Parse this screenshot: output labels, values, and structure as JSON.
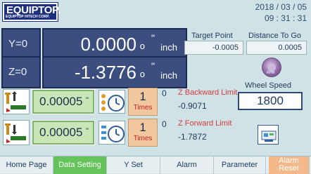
{
  "header": {
    "logo_main": "EQUIPTOP.",
    "logo_sub": "EQUIPTOP HITECH CORP.",
    "date": "2018 / 03 / 05",
    "time": "09 : 31 : 31"
  },
  "axes": [
    {
      "label": "Y=0",
      "value": "0.0000",
      "suffix": "o",
      "tick": "\"",
      "unit": "inch"
    },
    {
      "label": "Z=0",
      "value": "-1.3776",
      "suffix": "o",
      "tick": "\"",
      "unit": "inch"
    }
  ],
  "target": {
    "label": "Target Point",
    "value": "-0.0005"
  },
  "distance": {
    "label": "Distance To Go",
    "value": "0.0005"
  },
  "wheel": {
    "icon_text": "RPM",
    "label": "Wheel Speed",
    "value": "1800"
  },
  "rows": [
    {
      "step": "0.00005",
      "step_mark": "\"",
      "times": "1",
      "times_label": "Times",
      "zero": "0",
      "limit_label": "Z Backward Limit",
      "limit_value": "-0.9071"
    },
    {
      "step": "0.00005",
      "step_mark": "\"",
      "times": "1",
      "times_label": "Times",
      "zero": "0",
      "limit_label": "Z Forward Limit",
      "limit_value": "-1.7872"
    }
  ],
  "tabs": [
    {
      "label": "Home Page"
    },
    {
      "label": "Data Setting"
    },
    {
      "label": "Y Set"
    },
    {
      "label": "Alarm"
    },
    {
      "label": "Parameter"
    },
    {
      "label": "Alarm Reset"
    }
  ],
  "colors": {
    "accent_active_tab": "#64c35a",
    "alarm_reset": "#f4b98a",
    "axis_panel": "#3b4e7f"
  }
}
